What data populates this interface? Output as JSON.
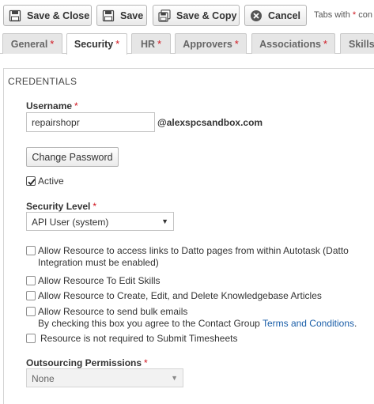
{
  "toolbar": {
    "save_close_label": "Save & Close",
    "save_label": "Save",
    "save_copy_label": "Save & Copy",
    "cancel_label": "Cancel",
    "required_note_prefix": "Tabs with",
    "required_note_star": "*",
    "required_note_suffix": "con"
  },
  "tabs": [
    {
      "label": "General",
      "required": "*"
    },
    {
      "label": "Security",
      "required": "*"
    },
    {
      "label": "HR",
      "required": "*"
    },
    {
      "label": "Approvers",
      "required": "*"
    },
    {
      "label": "Associations",
      "required": "*"
    },
    {
      "label": "Skills",
      "required": ""
    }
  ],
  "credentials": {
    "section_title": "CREDENTIALS",
    "username_label": "Username",
    "required_star": "*",
    "username_value": "repairshopr",
    "domain": "@alexspcsandbox.com",
    "change_password_label": "Change Password",
    "active_label": "Active",
    "active_checked": true,
    "security_level_label": "Security Level",
    "security_level_value": "API User (system)"
  },
  "options": {
    "datto_line1": "Allow Resource to access links to Datto pages from within Autotask (Datto",
    "datto_line2": "Integration must be enabled)",
    "edit_skills": "Allow Resource To Edit Skills",
    "kb_articles": "Allow Resource to Create, Edit, and Delete Knowledgebase Articles",
    "bulk_emails": "Allow Resource to send bulk emails",
    "bulk_agree_prefix": "By checking this box you agree to the Contact Group",
    "bulk_agree_link": "Terms and Conditions",
    "bulk_agree_suffix": ".",
    "timesheets": "Resource is not required to Submit Timesheets"
  },
  "outsourcing": {
    "label": "Outsourcing Permissions",
    "value": "None"
  },
  "icons": {
    "save": "floppy-disk-icon",
    "cancel": "cancel-x-icon",
    "checkbox": "checkmark-icon",
    "dropdown": "caret-down-icon"
  }
}
